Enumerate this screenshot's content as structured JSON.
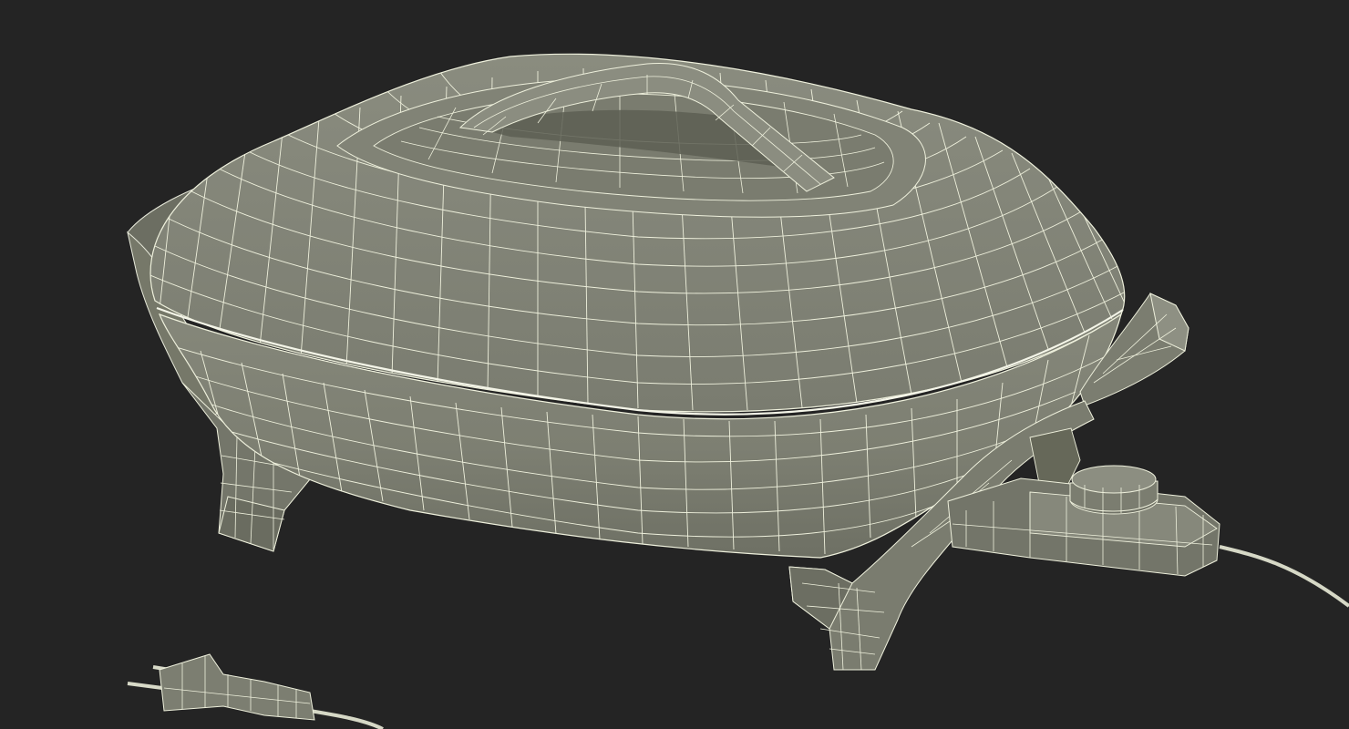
{
  "scene": {
    "subject": "electric-skillet-wireframe-render",
    "background_color": "#242424",
    "mesh_fill_color": "#7c7e6f",
    "mesh_shadow_color": "#5f6154",
    "wire_color": "#eef0dc"
  }
}
